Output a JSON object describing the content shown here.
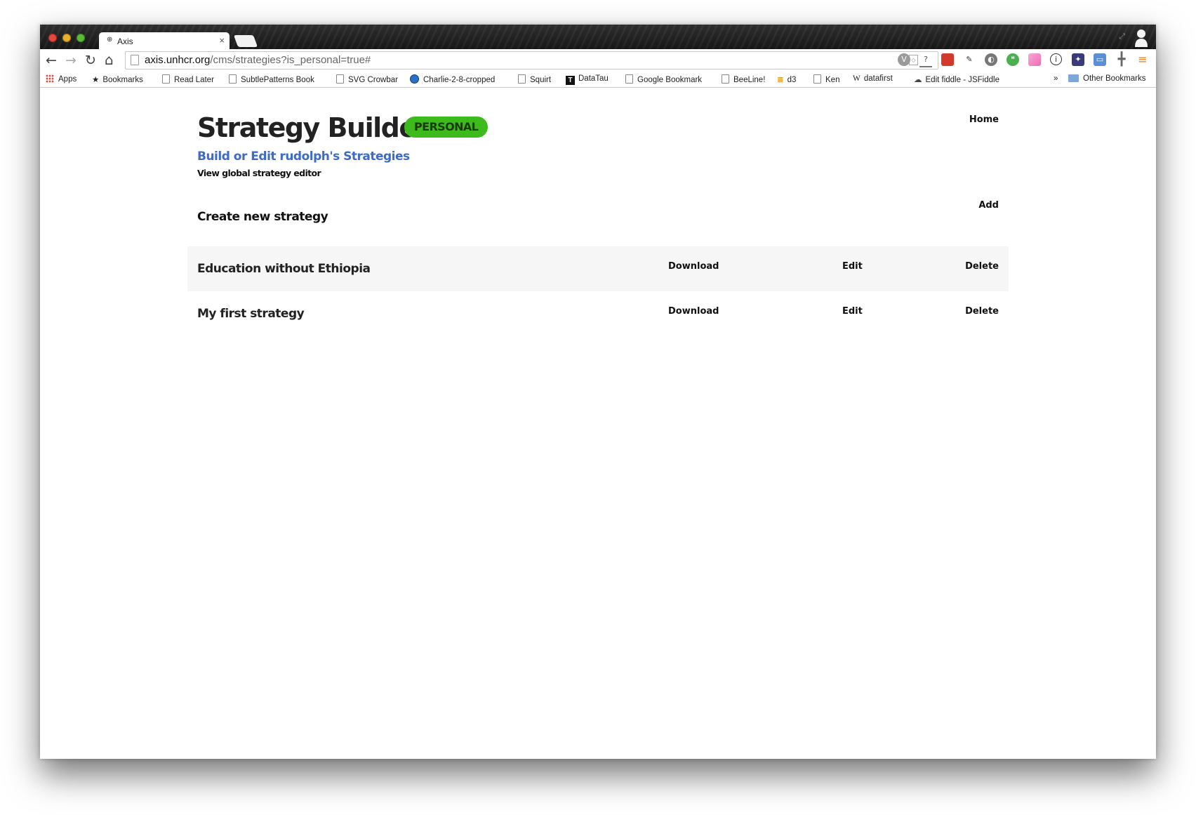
{
  "browser": {
    "tab_title": "Axis",
    "tab_close": "×",
    "url_host": "axis.unhcr.org",
    "url_path": "/cms/strategies?is_personal=true#",
    "nav": {
      "back": "←",
      "forward": "→",
      "reload": "↻",
      "home": "⌂"
    },
    "bookmarks": [
      {
        "label": "Apps",
        "icon": "apps-grid-icon"
      },
      {
        "label": "Bookmarks",
        "icon": "star-icon"
      },
      {
        "label": "Read Later",
        "icon": "page-icon"
      },
      {
        "label": "SubtlePatterns Book",
        "icon": "page-icon"
      },
      {
        "label": "SVG Crowbar",
        "icon": "page-icon"
      },
      {
        "label": "Charlie-2-8-cropped",
        "icon": "globe-icon"
      },
      {
        "label": "Squirt",
        "icon": "page-icon"
      },
      {
        "label": "DataTau",
        "icon": "datatau-icon"
      },
      {
        "label": "Google Bookmark",
        "icon": "page-icon"
      },
      {
        "label": "BeeLine!",
        "icon": "page-icon"
      },
      {
        "label": "d3",
        "icon": "stack-icon"
      },
      {
        "label": "Ken",
        "icon": "page-icon"
      },
      {
        "label": "datafirst",
        "icon": "wikipedia-icon"
      },
      {
        "label": "Edit fiddle - JSFiddle",
        "icon": "cloud-icon"
      }
    ],
    "bookmarks_overflow": "»",
    "other_bookmarks": "Other Bookmarks"
  },
  "header": {
    "title": "Strategy Builder",
    "badge": "PERSONAL",
    "subtitle": "Build or Edit rudolph's Strategies",
    "global_link": "View global strategy editor",
    "nav_home": "Home"
  },
  "create": {
    "title": "Create new strategy",
    "add_label": "Add"
  },
  "strategies": [
    {
      "name": "Education without Ethiopia",
      "download": "Download",
      "edit": "Edit",
      "delete": "Delete"
    },
    {
      "name": "My first strategy",
      "download": "Download",
      "edit": "Edit",
      "delete": "Delete"
    }
  ],
  "colors": {
    "badge_bg": "#3dbb1c",
    "link_blue": "#3c6bc9",
    "row_shade": "#f6f6f6"
  }
}
